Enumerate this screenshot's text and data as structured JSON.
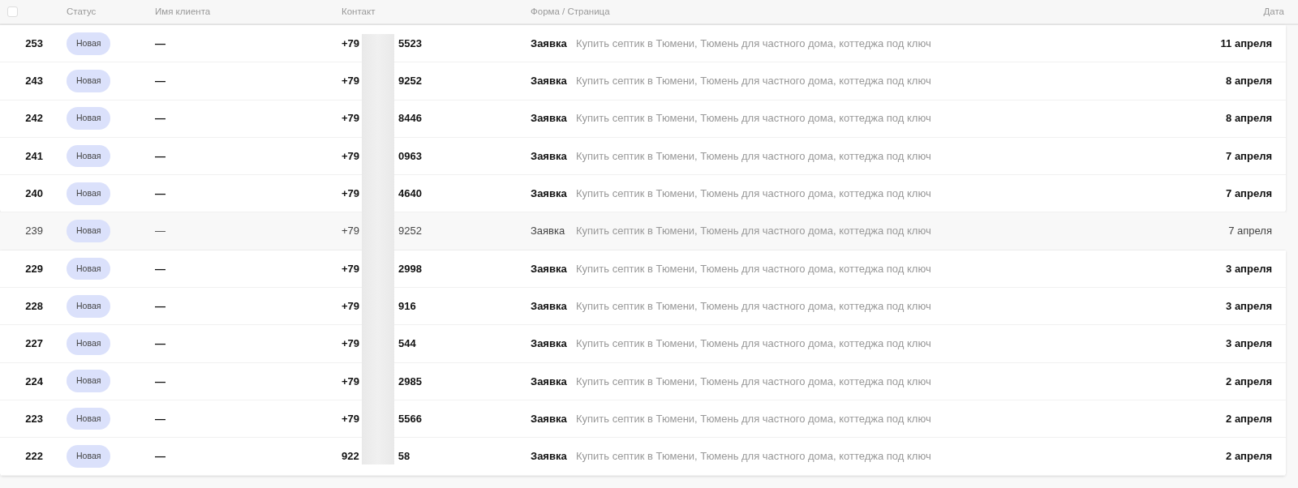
{
  "table": {
    "select_all": {
      "checked": false
    },
    "columns": [
      "Статус",
      "Имя клиента",
      "Контакт",
      "Форма / Страница",
      "Дата"
    ],
    "rows": [
      {
        "number": "253",
        "status": "Новая",
        "client": "—",
        "contact_start": "+79",
        "contact_end": "5523",
        "form": "Заявка",
        "page": "Купить септик в Тюмени, Тюмень для частного дома, коттеджа под ключ",
        "date": "11 апреля",
        "viewed": false
      },
      {
        "number": "243",
        "status": "Новая",
        "client": "—",
        "contact_start": "+79",
        "contact_end": "9252",
        "form": "Заявка",
        "page": "Купить септик в Тюмени, Тюмень для частного дома, коттеджа под ключ",
        "date": "8 апреля",
        "viewed": false
      },
      {
        "number": "242",
        "status": "Новая",
        "client": "—",
        "contact_start": "+79",
        "contact_end": "8446",
        "form": "Заявка",
        "page": "Купить септик в Тюмени, Тюмень для частного дома, коттеджа под ключ",
        "date": "8 апреля",
        "viewed": false
      },
      {
        "number": "241",
        "status": "Новая",
        "client": "—",
        "contact_start": "+79",
        "contact_end": "0963",
        "form": "Заявка",
        "page": "Купить септик в Тюмени, Тюмень для частного дома, коттеджа под ключ",
        "date": "7 апреля",
        "viewed": false
      },
      {
        "number": "240",
        "status": "Новая",
        "client": "—",
        "contact_start": "+79",
        "contact_end": "4640",
        "form": "Заявка",
        "page": "Купить септик в Тюмени, Тюмень для частного дома, коттеджа под ключ",
        "date": "7 апреля",
        "viewed": false
      },
      {
        "number": "239",
        "status": "Новая",
        "client": "—",
        "contact_start": "+79",
        "contact_end": "9252",
        "form": "Заявка",
        "page": "Купить септик в Тюмени, Тюмень для частного дома, коттеджа под ключ",
        "date": "7 апреля",
        "viewed": true
      },
      {
        "number": "229",
        "status": "Новая",
        "client": "—",
        "contact_start": "+79",
        "contact_end": "2998",
        "form": "Заявка",
        "page": "Купить септик в Тюмени, Тюмень для частного дома, коттеджа под ключ",
        "date": "3 апреля",
        "viewed": false
      },
      {
        "number": "228",
        "status": "Новая",
        "client": "—",
        "contact_start": "+79",
        "contact_end": "916",
        "form": "Заявка",
        "page": "Купить септик в Тюмени, Тюмень для частного дома, коттеджа под ключ",
        "date": "3 апреля",
        "viewed": false
      },
      {
        "number": "227",
        "status": "Новая",
        "client": "—",
        "contact_start": "+79",
        "contact_end": "544",
        "form": "Заявка",
        "page": "Купить септик в Тюмени, Тюмень для частного дома, коттеджа под ключ",
        "date": "3 апреля",
        "viewed": false
      },
      {
        "number": "224",
        "status": "Новая",
        "client": "—",
        "contact_start": "+79",
        "contact_end": "2985",
        "form": "Заявка",
        "page": "Купить септик в Тюмени, Тюмень для частного дома, коттеджа под ключ",
        "date": "2 апреля",
        "viewed": false
      },
      {
        "number": "223",
        "status": "Новая",
        "client": "—",
        "contact_start": "+79",
        "contact_end": "5566",
        "form": "Заявка",
        "page": "Купить септик в Тюмени, Тюмень для частного дома, коттеджа под ключ",
        "date": "2 апреля",
        "viewed": false
      },
      {
        "number": "222",
        "status": "Новая",
        "client": "—",
        "contact_start": "922",
        "contact_end": "58",
        "form": "Заявка",
        "page": "Купить септик в Тюмени, Тюмень для частного дома, коттеджа под ключ",
        "date": "2 апреля",
        "viewed": false
      }
    ]
  }
}
